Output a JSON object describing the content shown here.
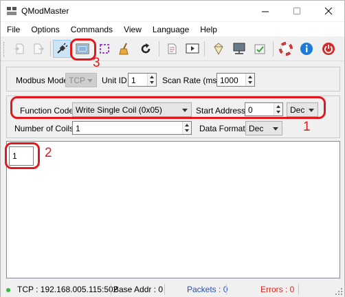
{
  "window": {
    "title": "QModMaster"
  },
  "menu": [
    "File",
    "Options",
    "Commands",
    "View",
    "Language",
    "Help"
  ],
  "toolbar": {
    "buttons": [
      "connect-icon",
      "disconnect-icon",
      "plug-icon",
      "bus-monitor-icon",
      "select-icon",
      "clear-icon",
      "refresh-icon",
      "log-icon",
      "play-icon",
      "network-icon",
      "register-icon",
      "checkbox-icon",
      "help-icon",
      "info-icon",
      "exit-icon"
    ]
  },
  "connection": {
    "modbus_mode_label": "Modbus Mode",
    "modbus_mode_value": "TCP",
    "unit_id_label": "Unit ID",
    "unit_id_value": "1",
    "scan_rate_label": "Scan Rate (ms)",
    "scan_rate_value": "1000"
  },
  "request": {
    "function_code_label": "Function Code",
    "function_code_value": "Write Single Coil (0x05)",
    "start_address_label": "Start Address",
    "start_address_value": "0",
    "start_address_format": "Dec",
    "num_coils_label": "Number of Coils",
    "num_coils_value": "1",
    "data_format_label": "Data Format",
    "data_format_value": "Dec"
  },
  "data_grid": {
    "cell_value": "1"
  },
  "annotations": {
    "n1": "1",
    "n2": "2",
    "n3": "3"
  },
  "status": {
    "connection": "TCP : 192.168.005.115:502",
    "base_addr": "Base Addr : 0",
    "packets": "Packets : 0",
    "errors": "Errors : 0"
  },
  "colors": {
    "annotation": "#e0191e",
    "packets": "#1f4fbf",
    "errors": "#d9261c",
    "status_ok": "#2dbd3a"
  }
}
